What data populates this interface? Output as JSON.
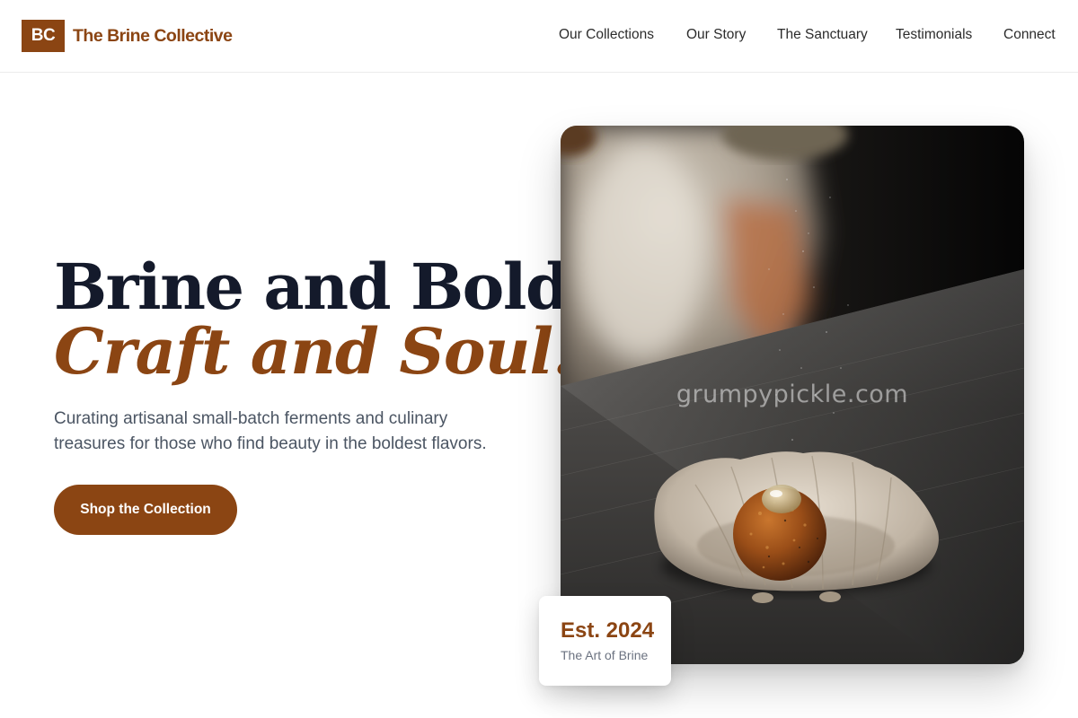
{
  "brand": {
    "mark": "BC",
    "name": "The Brine Collective",
    "accent_color": "#8b4513"
  },
  "nav": {
    "items": [
      {
        "label": "Our Collections"
      },
      {
        "label": "Our Story"
      },
      {
        "label": "The Sanctuary"
      },
      {
        "label": "Testimonials"
      },
      {
        "label": "Connect"
      }
    ]
  },
  "hero": {
    "title_line1": "Brine and Bold,",
    "title_line2": "Craft and Soul.",
    "subtitle": "Curating artisanal small-batch ferments and culinary treasures for those who find beauty in the boldest flavors.",
    "cta_label": "Shop the Collection",
    "image_watermark": "grumpypickle.com",
    "image_alt": "Chef seasoning a fried ball on a ceramic shell dish",
    "title_color": "#141a2b"
  },
  "badge": {
    "year": "Est. 2024",
    "caption": "The Art of Brine"
  }
}
